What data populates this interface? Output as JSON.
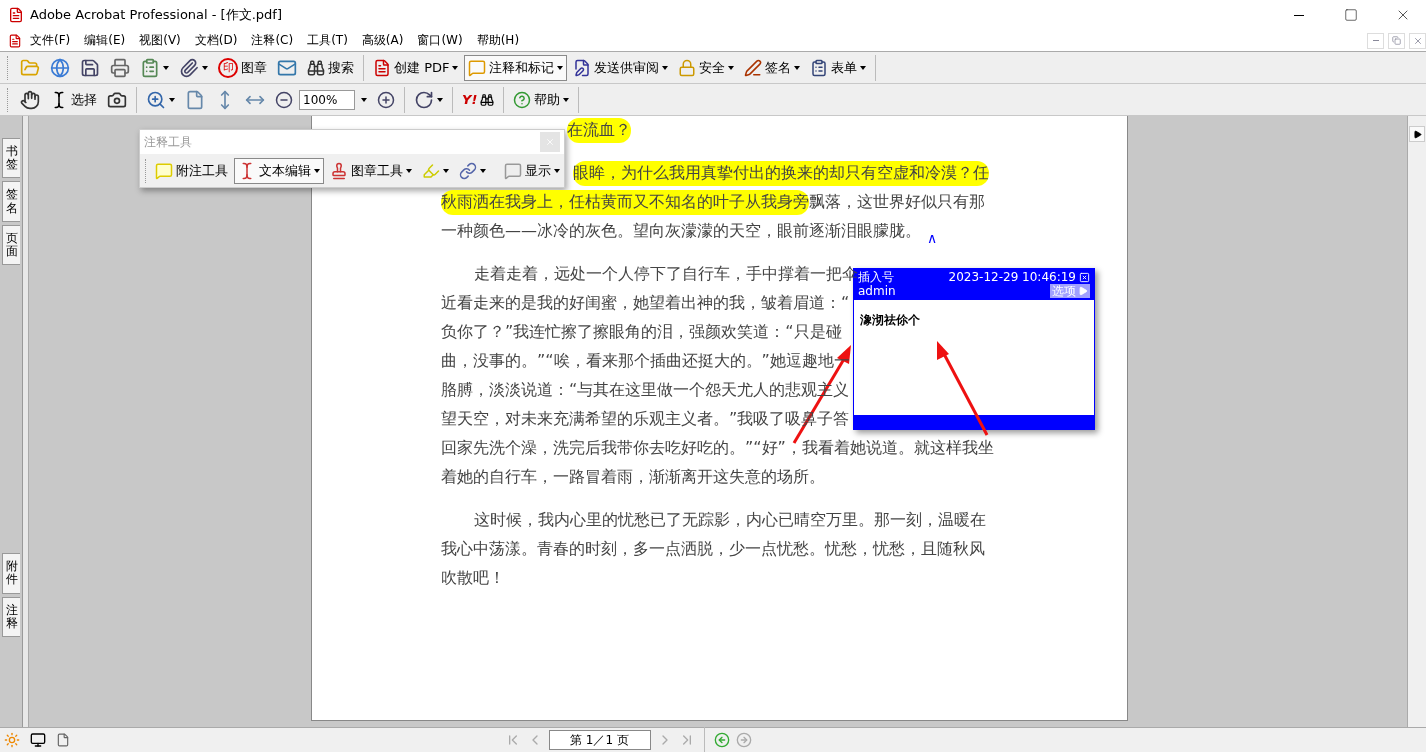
{
  "window": {
    "title": "Adobe Acrobat Professional - [作文.pdf]"
  },
  "menu": [
    "文件(F)",
    "编辑(E)",
    "视图(V)",
    "文档(D)",
    "注释(C)",
    "工具(T)",
    "高级(A)",
    "窗口(W)",
    "帮助(H)"
  ],
  "toolbar_1": {
    "stamp_glyph": "印",
    "buttons": [
      {
        "label": "图章",
        "dropdown": false,
        "pressed": false
      },
      {
        "label": "搜索",
        "dropdown": false,
        "pressed": false
      },
      {
        "label": "创建 PDF",
        "dropdown": true,
        "pressed": false
      },
      {
        "label": "注释和标记",
        "dropdown": true,
        "pressed": true
      },
      {
        "label": "发送供审阅",
        "dropdown": true,
        "pressed": false
      },
      {
        "label": "安全",
        "dropdown": true,
        "pressed": false
      },
      {
        "label": "签名",
        "dropdown": true,
        "pressed": false
      },
      {
        "label": "表单",
        "dropdown": true,
        "pressed": false
      }
    ]
  },
  "toolbar_2": {
    "select_label": "选择",
    "zoom": "100%",
    "search_logo": "Y!",
    "help_label": "帮助"
  },
  "left_tabs_top": [
    "书签",
    "签名",
    "页面"
  ],
  "left_tabs_bottom": [
    "附件",
    "注释"
  ],
  "comment_toolbar": {
    "title": "注释工具",
    "buttons": [
      {
        "label": "附注工具",
        "dropdown": false,
        "pressed": false
      },
      {
        "label": "文本编辑",
        "dropdown": true,
        "pressed": true
      },
      {
        "label": "图章工具",
        "dropdown": true,
        "pressed": false
      },
      {
        "label": "显示",
        "dropdown": true,
        "pressed": false
      }
    ]
  },
  "document": {
    "paragraphs": [
      {
        "lines": [
          {
            "kind": "after_toolbar",
            "segments": [
              {
                "text": "在流血？",
                "highlight": true
              }
            ]
          }
        ]
      },
      {
        "lines": [
          {
            "kind": "partial",
            "segments": [
              {
                "text": "眼眸，为什么我用真挚付出的换来的却只有空虚和冷漠？任",
                "highlight": true
              }
            ]
          },
          {
            "kind": "full",
            "segments": [
              {
                "text": "秋雨洒在我身上，任枯黄而又不知名的叶子从我身旁",
                "highlight": true
              },
              {
                "text": "飘落，这世界好似只有那",
                "highlight": false
              }
            ]
          },
          {
            "kind": "full",
            "segments": [
              {
                "text": "一种颜色——冰冷的灰色。望向灰濛濛的天空，眼前逐渐泪眼朦胧。",
                "highlight": false
              }
            ],
            "mark": "∧"
          }
        ]
      },
      {
        "lines": [
          {
            "kind": "first",
            "segments": [
              {
                "text": "走着走着，远处一个人停下了自行车，手中撑着一把伞",
                "highlight": false
              }
            ]
          },
          {
            "kind": "full",
            "segments": [
              {
                "text": "近看走来的是我的好闺蜜，她望着出神的我，皱着眉道：“",
                "highlight": false
              }
            ]
          },
          {
            "kind": "full",
            "segments": [
              {
                "text": "负你了？”我连忙擦了擦眼角的泪，强颜欢笑道：“只是碰",
                "highlight": false
              }
            ]
          },
          {
            "kind": "full",
            "segments": [
              {
                "text": "曲，没事的。”“唉，看来那个插曲还挺大的。”她逗趣地一",
                "highlight": false
              }
            ]
          },
          {
            "kind": "full",
            "segments": [
              {
                "text": "胳膊，淡淡说道：“与其在这里做一个怨天尤人的悲观主义",
                "highlight": false
              }
            ]
          },
          {
            "kind": "full",
            "segments": [
              {
                "text": "望天空，对未来充满希望的乐观主义者。”我吸了吸鼻子答",
                "highlight": false
              }
            ]
          },
          {
            "kind": "full",
            "segments": [
              {
                "text": "回家先洗个澡，洗完后我带你去吃好吃的。”“好”，我看着她说道。就这样我坐",
                "highlight": false
              }
            ]
          },
          {
            "kind": "full",
            "segments": [
              {
                "text": "着她的自行车，一路冒着雨，渐渐离开这失意的场所。",
                "highlight": false
              }
            ]
          }
        ]
      },
      {
        "lines": [
          {
            "kind": "first",
            "segments": [
              {
                "text": "这时候，我内心里的忧愁已了无踪影，内心已晴空万里。那一刻，温暖在",
                "highlight": false
              }
            ]
          },
          {
            "kind": "full",
            "segments": [
              {
                "text": "我心中荡漾。青春的时刻，多一点洒脱，少一点忧愁。忧愁，忧愁，且随秋风",
                "highlight": false
              }
            ]
          },
          {
            "kind": "full",
            "segments": [
              {
                "text": "吹散吧！",
                "highlight": false
              }
            ]
          }
        ]
      }
    ]
  },
  "note_popup": {
    "title": "插入号",
    "timestamp": "2023-12-29 10:46:19",
    "author": "admin",
    "options_label": "选项",
    "body": "潒沏祛伱个"
  },
  "status_bar": {
    "page_field": "第 1／1 页"
  }
}
